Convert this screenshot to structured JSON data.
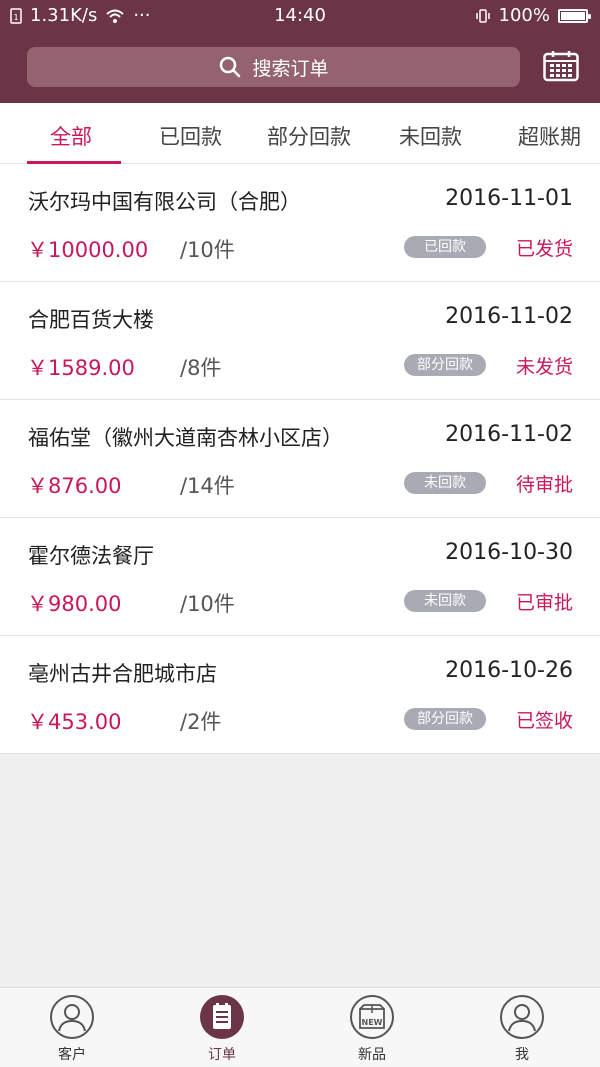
{
  "status_bar": {
    "speed": "1.31K/s",
    "dots": "···",
    "time": "14:40",
    "battery": "100%"
  },
  "search": {
    "placeholder": "搜索订单",
    "icon": "search-icon"
  },
  "calendar_icon": "calendar-icon",
  "tabs": [
    {
      "label": "全部",
      "active": true
    },
    {
      "label": "已回款"
    },
    {
      "label": "部分回款"
    },
    {
      "label": "未回款"
    },
    {
      "label": "超账期"
    }
  ],
  "orders": [
    {
      "name": "沃尔玛中国有限公司（合肥）",
      "date": "2016-11-01",
      "price": "￥10000.00",
      "qty": "/10件",
      "payment": "已回款",
      "status": "已发货"
    },
    {
      "name": "合肥百货大楼",
      "date": "2016-11-02",
      "price": "￥1589.00",
      "qty": "/8件",
      "payment": "部分回款",
      "status": "未发货"
    },
    {
      "name": "福佑堂（徽州大道南杏林小区店）",
      "date": "2016-11-02",
      "price": "￥876.00",
      "qty": "/14件",
      "payment": "未回款",
      "status": "待审批"
    },
    {
      "name": "霍尔德法餐厅",
      "date": "2016-10-30",
      "price": "￥980.00",
      "qty": "/10件",
      "payment": "未回款",
      "status": "已审批"
    },
    {
      "name": "亳州古井合肥城市店",
      "date": "2016-10-26",
      "price": "￥453.00",
      "qty": "/2件",
      "payment": "部分回款",
      "status": "已签收"
    }
  ],
  "bottom_nav": [
    {
      "label": "客户",
      "icon": "customer-icon"
    },
    {
      "label": "订单",
      "icon": "order-icon",
      "active": true
    },
    {
      "label": "新品",
      "icon": "new-product-icon"
    },
    {
      "label": "我",
      "icon": "profile-icon"
    }
  ],
  "colors": {
    "header": "#6b3447",
    "accent": "#c8185a",
    "badge": "#a9abb4"
  }
}
